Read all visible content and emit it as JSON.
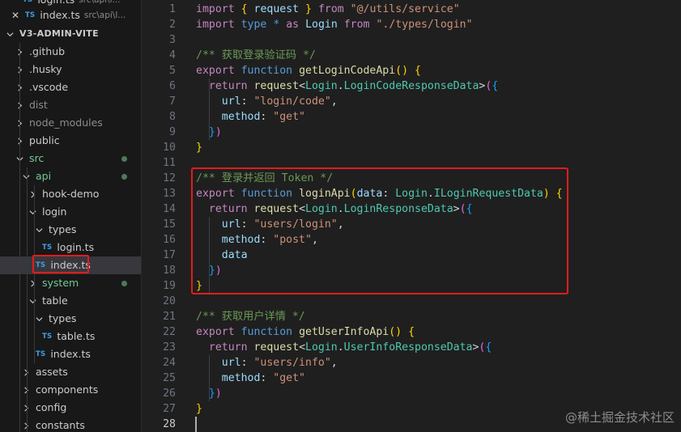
{
  "sidebar": {
    "open_editors": [
      {
        "icon": "ts-file-icon",
        "name": "login.ts",
        "desc": "src\\api\\l...",
        "partial": true
      },
      {
        "icon": "ts-file-icon",
        "name": "index.ts",
        "desc": "src\\api\\l..."
      }
    ],
    "project_title": "V3-ADMIN-VITE",
    "tree": [
      {
        "label": "V3-ADMIN-VITE",
        "depth": 0,
        "kind": "root"
      },
      {
        "label": ".github",
        "depth": 1,
        "kind": "folder",
        "open": false
      },
      {
        "label": ".husky",
        "depth": 1,
        "kind": "folder",
        "open": false
      },
      {
        "label": ".vscode",
        "depth": 1,
        "kind": "folder",
        "open": false
      },
      {
        "label": "dist",
        "depth": 1,
        "kind": "folder",
        "open": false,
        "dim": true
      },
      {
        "label": "node_modules",
        "depth": 1,
        "kind": "folder",
        "open": false,
        "dim": true
      },
      {
        "label": "public",
        "depth": 1,
        "kind": "folder",
        "open": false
      },
      {
        "label": "src",
        "depth": 1,
        "kind": "folder",
        "open": true,
        "modified": true,
        "dot": true
      },
      {
        "label": "api",
        "depth": 2,
        "kind": "folder",
        "open": true,
        "modified": true,
        "dot": true
      },
      {
        "label": "hook-demo",
        "depth": 3,
        "kind": "folder",
        "open": false
      },
      {
        "label": "login",
        "depth": 3,
        "kind": "folder",
        "open": true
      },
      {
        "label": "types",
        "depth": 4,
        "kind": "folder",
        "open": true
      },
      {
        "label": "login.ts",
        "depth": 5,
        "kind": "ts"
      },
      {
        "label": "index.ts",
        "depth": 4,
        "kind": "ts",
        "selected": true
      },
      {
        "label": "system",
        "depth": 3,
        "kind": "folder",
        "open": false,
        "modified": true,
        "dot": true
      },
      {
        "label": "table",
        "depth": 3,
        "kind": "folder",
        "open": true
      },
      {
        "label": "types",
        "depth": 4,
        "kind": "folder",
        "open": true
      },
      {
        "label": "table.ts",
        "depth": 5,
        "kind": "ts"
      },
      {
        "label": "index.ts",
        "depth": 4,
        "kind": "ts"
      },
      {
        "label": "assets",
        "depth": 2,
        "kind": "folder",
        "open": false
      },
      {
        "label": "components",
        "depth": 2,
        "kind": "folder",
        "open": false
      },
      {
        "label": "config",
        "depth": 2,
        "kind": "folder",
        "open": false
      },
      {
        "label": "constants",
        "depth": 2,
        "kind": "folder",
        "open": false
      }
    ],
    "ts_badge": "TS",
    "close_glyph": "✕"
  },
  "editor": {
    "active_line": 28,
    "lines": [
      {
        "n": 1,
        "tokens": [
          [
            "kw2",
            "import"
          ],
          [
            "pun",
            " "
          ],
          [
            "br1",
            "{"
          ],
          [
            "pun",
            " "
          ],
          [
            "var",
            "request"
          ],
          [
            "pun",
            " "
          ],
          [
            "br1",
            "}"
          ],
          [
            "pun",
            " "
          ],
          [
            "kw2",
            "from"
          ],
          [
            "pun",
            " "
          ],
          [
            "str",
            "\"@/utils/service\""
          ]
        ]
      },
      {
        "n": 2,
        "tokens": [
          [
            "kw2",
            "import"
          ],
          [
            "pun",
            " "
          ],
          [
            "kw",
            "type"
          ],
          [
            "pun",
            " "
          ],
          [
            "kw",
            "*"
          ],
          [
            "pun",
            " "
          ],
          [
            "kw2",
            "as"
          ],
          [
            "pun",
            " "
          ],
          [
            "var",
            "Login"
          ],
          [
            "pun",
            " "
          ],
          [
            "kw2",
            "from"
          ],
          [
            "pun",
            " "
          ],
          [
            "str",
            "\"./types/login\""
          ]
        ]
      },
      {
        "n": 3,
        "tokens": []
      },
      {
        "n": 4,
        "tokens": [
          [
            "com",
            "/** 获取登录验证码 */"
          ]
        ]
      },
      {
        "n": 5,
        "tokens": [
          [
            "kw2",
            "export"
          ],
          [
            "pun",
            " "
          ],
          [
            "kw",
            "function"
          ],
          [
            "pun",
            " "
          ],
          [
            "fn",
            "getLoginCodeApi"
          ],
          [
            "br1",
            "()"
          ],
          [
            "pun",
            " "
          ],
          [
            "br1",
            "{"
          ]
        ]
      },
      {
        "n": 6,
        "tokens": [
          [
            "pun",
            "  "
          ],
          [
            "kw2",
            "return"
          ],
          [
            "pun",
            " "
          ],
          [
            "fn",
            "request"
          ],
          [
            "pun",
            "<"
          ],
          [
            "typ",
            "Login"
          ],
          [
            "pun",
            "."
          ],
          [
            "typ",
            "LoginCodeResponseData"
          ],
          [
            "pun",
            ">"
          ],
          [
            "br2",
            "("
          ],
          [
            "br3",
            "{"
          ]
        ]
      },
      {
        "n": 7,
        "tokens": [
          [
            "pun",
            "    "
          ],
          [
            "var",
            "url"
          ],
          [
            "pun",
            ": "
          ],
          [
            "str",
            "\"login/code\""
          ],
          [
            "pun",
            ","
          ]
        ]
      },
      {
        "n": 8,
        "tokens": [
          [
            "pun",
            "    "
          ],
          [
            "var",
            "method"
          ],
          [
            "pun",
            ": "
          ],
          [
            "str",
            "\"get\""
          ]
        ]
      },
      {
        "n": 9,
        "tokens": [
          [
            "pun",
            "  "
          ],
          [
            "br3",
            "}"
          ],
          [
            "br2",
            ")"
          ]
        ]
      },
      {
        "n": 10,
        "tokens": [
          [
            "br1",
            "}"
          ]
        ]
      },
      {
        "n": 11,
        "tokens": []
      },
      {
        "n": 12,
        "tokens": [
          [
            "com",
            "/** 登录并返回 Token */"
          ]
        ]
      },
      {
        "n": 13,
        "tokens": [
          [
            "kw2",
            "export"
          ],
          [
            "pun",
            " "
          ],
          [
            "kw",
            "function"
          ],
          [
            "pun",
            " "
          ],
          [
            "fn",
            "loginApi"
          ],
          [
            "br1",
            "("
          ],
          [
            "var",
            "data"
          ],
          [
            "pun",
            ": "
          ],
          [
            "typ",
            "Login"
          ],
          [
            "pun",
            "."
          ],
          [
            "typ",
            "ILoginRequestData"
          ],
          [
            "br1",
            ")"
          ],
          [
            "pun",
            " "
          ],
          [
            "br1",
            "{"
          ]
        ]
      },
      {
        "n": 14,
        "tokens": [
          [
            "pun",
            "  "
          ],
          [
            "kw2",
            "return"
          ],
          [
            "pun",
            " "
          ],
          [
            "fn",
            "request"
          ],
          [
            "pun",
            "<"
          ],
          [
            "typ",
            "Login"
          ],
          [
            "pun",
            "."
          ],
          [
            "typ",
            "LoginResponseData"
          ],
          [
            "pun",
            ">"
          ],
          [
            "br2",
            "("
          ],
          [
            "br3",
            "{"
          ]
        ]
      },
      {
        "n": 15,
        "tokens": [
          [
            "pun",
            "    "
          ],
          [
            "var",
            "url"
          ],
          [
            "pun",
            ": "
          ],
          [
            "str",
            "\"users/login\""
          ],
          [
            "pun",
            ","
          ]
        ]
      },
      {
        "n": 16,
        "tokens": [
          [
            "pun",
            "    "
          ],
          [
            "var",
            "method"
          ],
          [
            "pun",
            ": "
          ],
          [
            "str",
            "\"post\""
          ],
          [
            "pun",
            ","
          ]
        ]
      },
      {
        "n": 17,
        "tokens": [
          [
            "pun",
            "    "
          ],
          [
            "var",
            "data"
          ]
        ]
      },
      {
        "n": 18,
        "tokens": [
          [
            "pun",
            "  "
          ],
          [
            "br3",
            "}"
          ],
          [
            "br2",
            ")"
          ]
        ]
      },
      {
        "n": 19,
        "tokens": [
          [
            "br1",
            "}"
          ]
        ]
      },
      {
        "n": 20,
        "tokens": []
      },
      {
        "n": 21,
        "tokens": [
          [
            "com",
            "/** 获取用户详情 */"
          ]
        ]
      },
      {
        "n": 22,
        "tokens": [
          [
            "kw2",
            "export"
          ],
          [
            "pun",
            " "
          ],
          [
            "kw",
            "function"
          ],
          [
            "pun",
            " "
          ],
          [
            "fn",
            "getUserInfoApi"
          ],
          [
            "br1",
            "()"
          ],
          [
            "pun",
            " "
          ],
          [
            "br1",
            "{"
          ]
        ]
      },
      {
        "n": 23,
        "tokens": [
          [
            "pun",
            "  "
          ],
          [
            "kw2",
            "return"
          ],
          [
            "pun",
            " "
          ],
          [
            "fn",
            "request"
          ],
          [
            "pun",
            "<"
          ],
          [
            "typ",
            "Login"
          ],
          [
            "pun",
            "."
          ],
          [
            "typ",
            "UserInfoResponseData"
          ],
          [
            "pun",
            ">"
          ],
          [
            "br2",
            "("
          ],
          [
            "br3",
            "{"
          ]
        ]
      },
      {
        "n": 24,
        "tokens": [
          [
            "pun",
            "    "
          ],
          [
            "var",
            "url"
          ],
          [
            "pun",
            ": "
          ],
          [
            "str",
            "\"users/info\""
          ],
          [
            "pun",
            ","
          ]
        ]
      },
      {
        "n": 25,
        "tokens": [
          [
            "pun",
            "    "
          ],
          [
            "var",
            "method"
          ],
          [
            "pun",
            ": "
          ],
          [
            "str",
            "\"get\""
          ]
        ]
      },
      {
        "n": 26,
        "tokens": [
          [
            "pun",
            "  "
          ],
          [
            "br3",
            "}"
          ],
          [
            "br2",
            ")"
          ]
        ]
      },
      {
        "n": 27,
        "tokens": [
          [
            "br1",
            "}"
          ]
        ]
      },
      {
        "n": 28,
        "tokens": []
      }
    ]
  },
  "watermark": "@稀土掘金技术社区"
}
